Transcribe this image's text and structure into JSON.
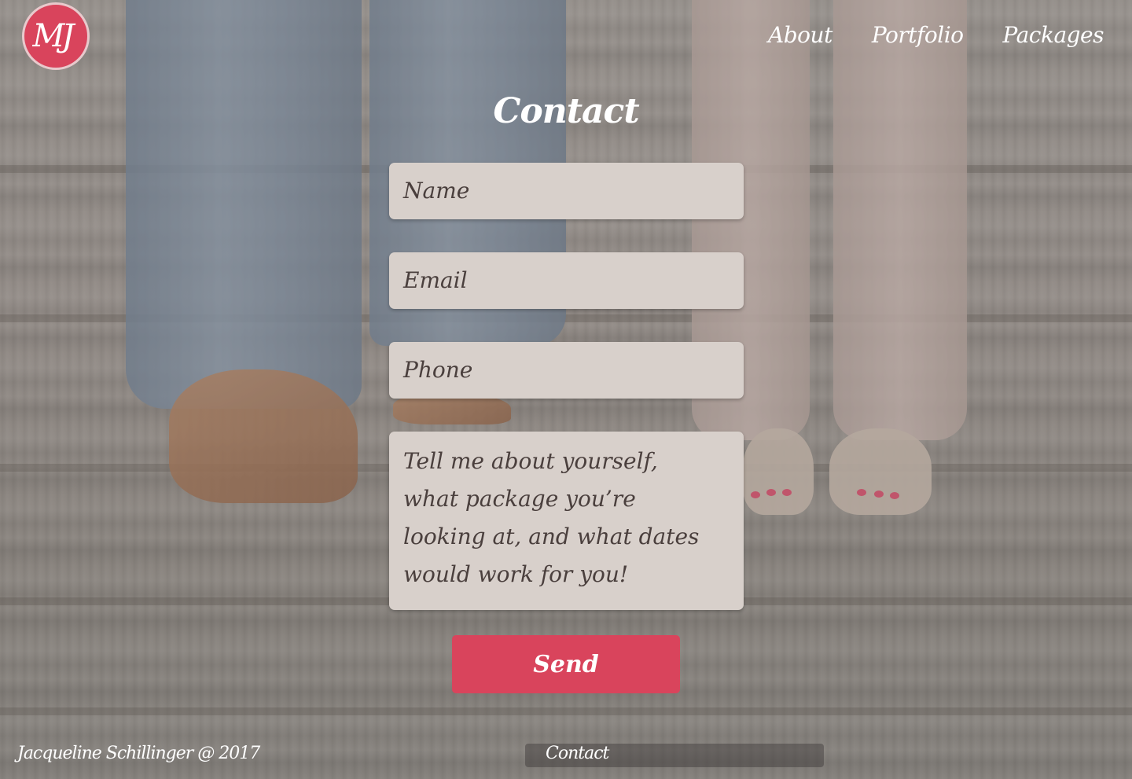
{
  "header": {
    "logo_text": "MJ",
    "nav": [
      {
        "label": "About"
      },
      {
        "label": "Portfolio"
      },
      {
        "label": "Packages"
      }
    ]
  },
  "main": {
    "title": "Contact",
    "form": {
      "name_placeholder": "Name",
      "email_placeholder": "Email",
      "phone_placeholder": "Phone",
      "message_placeholder_lines": [
        "Tell me about yourself,",
        "what package you’re",
        "looking at, and what dates",
        "would work for you!"
      ],
      "send_label": "Send"
    }
  },
  "footer": {
    "copyright": "Jacqueline Schillinger @ 2017",
    "contact_link": "Contact"
  },
  "colors": {
    "accent": "#d9445c",
    "field_bg": "#d8d0cb",
    "field_text": "#4a3f3d"
  }
}
